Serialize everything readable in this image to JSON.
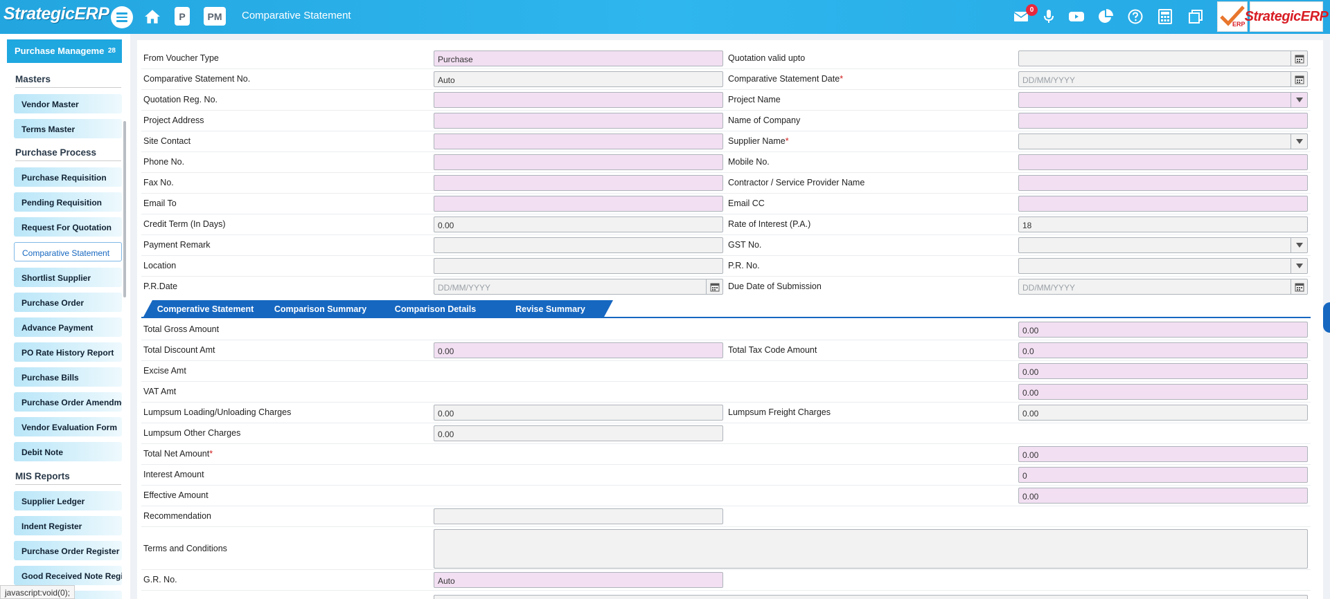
{
  "topbar": {
    "brand": "StrategicERP",
    "pill_p": "P",
    "pill_pm": "PM",
    "title": "Comparative Statement",
    "mail_badge": "0",
    "logo_right": "StrategicERP",
    "logo_small": "ERP"
  },
  "sidebar": {
    "module": "Purchase Manageme",
    "module_count": "28",
    "sections": {
      "masters": "Masters",
      "process": "Purchase Process",
      "reports": "MIS Reports"
    },
    "masters_items": [
      "Vendor Master",
      "Terms Master"
    ],
    "process_items": [
      "Purchase Requisition",
      "Pending Requisition",
      "Request For Quotation",
      "Comparative Statement",
      "Shortlist Supplier",
      "Purchase Order",
      "Advance Payment",
      "PO Rate History Report",
      "Purchase Bills",
      "Purchase Order Amendment",
      "Vendor Evaluation Form",
      "Debit Note"
    ],
    "report_items": [
      "Supplier Ledger",
      "Indent Register",
      "Purchase Order Register",
      "Good Received Note Regis.."
    ]
  },
  "form": {
    "from_voucher_type": {
      "label": "From Voucher Type",
      "value": "Purchase"
    },
    "quotation_valid_upto": {
      "label": "Quotation valid upto",
      "value": ""
    },
    "cs_no": {
      "label": "Comparative Statement No.",
      "value": "Auto"
    },
    "cs_date": {
      "label": "Comparative Statement Date",
      "placeholder": "DD/MM/YYYY"
    },
    "quotation_reg_no": {
      "label": "Quotation Reg. No.",
      "value": ""
    },
    "project_name": {
      "label": "Project Name",
      "value": ""
    },
    "project_address": {
      "label": "Project Address",
      "value": ""
    },
    "name_of_company": {
      "label": "Name of Company",
      "value": ""
    },
    "site_contact": {
      "label": "Site Contact",
      "value": ""
    },
    "supplier_name": {
      "label": "Supplier Name",
      "value": ""
    },
    "phone_no": {
      "label": "Phone No.",
      "value": ""
    },
    "mobile_no": {
      "label": "Mobile No.",
      "value": ""
    },
    "fax_no": {
      "label": "Fax No.",
      "value": ""
    },
    "contractor_name": {
      "label": "Contractor / Service Provider Name",
      "value": ""
    },
    "email_to": {
      "label": "Email To",
      "value": ""
    },
    "email_cc": {
      "label": "Email CC",
      "value": ""
    },
    "credit_term": {
      "label": "Credit Term (In Days)",
      "value": "0.00"
    },
    "rate_of_interest": {
      "label": "Rate of Interest (P.A.)",
      "value": "18"
    },
    "payment_remark": {
      "label": "Payment Remark",
      "value": ""
    },
    "gst_no": {
      "label": "GST No.",
      "value": ""
    },
    "location": {
      "label": "Location",
      "value": ""
    },
    "pr_no": {
      "label": "P.R. No.",
      "value": ""
    },
    "pr_date": {
      "label": "P.R.Date",
      "placeholder": "DD/MM/YYYY"
    },
    "due_date": {
      "label": "Due Date of Submission",
      "placeholder": "DD/MM/YYYY"
    }
  },
  "tabs": [
    "Comperative Statement",
    "Comparison Summary",
    "Comparison Details",
    "Revise Summary"
  ],
  "totals": {
    "total_gross": {
      "label": "Total Gross Amount",
      "value": "0.00"
    },
    "total_discount": {
      "label": "Total Discount Amt",
      "value": "0.00"
    },
    "total_tax_code": {
      "label": "Total Tax Code Amount",
      "value": "0.0"
    },
    "excise": {
      "label": "Excise Amt",
      "value": "0.00"
    },
    "vat": {
      "label": "VAT Amt",
      "value": "0.00"
    },
    "loading_charges": {
      "label": "Lumpsum Loading/Unloading Charges",
      "value": "0.00"
    },
    "freight_charges": {
      "label": "Lumpsum Freight Charges",
      "value": "0.00"
    },
    "other_charges": {
      "label": "Lumpsum Other Charges",
      "value": "0.00"
    },
    "total_net": {
      "label": "Total Net Amount",
      "value": "0.00"
    },
    "interest": {
      "label": "Interest Amount",
      "value": "0"
    },
    "effective": {
      "label": "Effective Amount",
      "value": "0.00"
    },
    "recommendation": {
      "label": "Recommendation",
      "value": ""
    },
    "terms": {
      "label": "Terms and Conditions",
      "value": ""
    },
    "gr_no": {
      "label": "G.R. No.",
      "value": "Auto"
    }
  },
  "required_mark": "*",
  "status_tip": "javascript:void(0);",
  "colors": {
    "topbar": "#2fb6ee",
    "tab": "#1667c0",
    "pink_field": "#f2dff2",
    "badge": "#e8273d"
  }
}
